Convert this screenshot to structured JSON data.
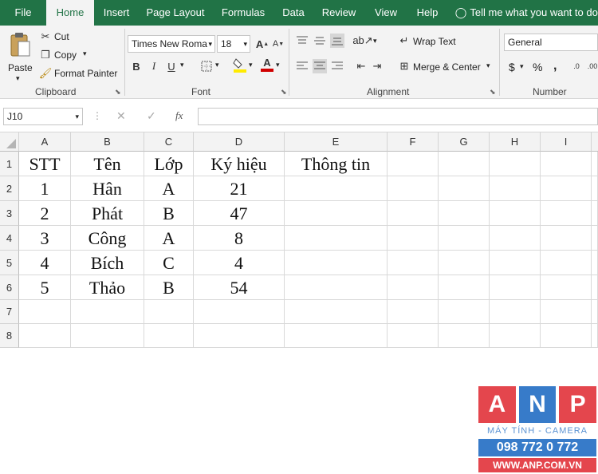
{
  "tabs": [
    "File",
    "Home",
    "Insert",
    "Page Layout",
    "Formulas",
    "Data",
    "Review",
    "View",
    "Help"
  ],
  "tell_me": "Tell me what you want to do",
  "clipboard": {
    "paste": "Paste",
    "cut": "Cut",
    "copy": "Copy",
    "format_painter": "Format Painter",
    "label": "Clipboard"
  },
  "font": {
    "name": "Times New Roma",
    "size": "18",
    "bold": "B",
    "italic": "I",
    "underline": "U",
    "font_color_glyph": "A",
    "label": "Font"
  },
  "alignment": {
    "wrap_text": "Wrap Text",
    "merge_center": "Merge & Center",
    "label": "Alignment"
  },
  "number": {
    "format": "General",
    "currency": "$",
    "percent": "%",
    "comma": ",",
    "label": "Number"
  },
  "formula_bar": {
    "name_box": "J10",
    "fx": "fx",
    "cancel": "✕",
    "enter": "✓"
  },
  "columns": [
    "A",
    "B",
    "C",
    "D",
    "E",
    "F",
    "G",
    "H",
    "I"
  ],
  "rows": [
    "1",
    "2",
    "3",
    "4",
    "5",
    "6",
    "7",
    "8"
  ],
  "cells": [
    [
      "STT",
      "Tên",
      "Lớp",
      "Ký hiệu",
      "Thông tin"
    ],
    [
      "1",
      "Hân",
      "A",
      "21",
      ""
    ],
    [
      "2",
      "Phát",
      "B",
      "47",
      ""
    ],
    [
      "3",
      "Công",
      "A",
      "8",
      ""
    ],
    [
      "4",
      "Bích",
      "C",
      "4",
      ""
    ],
    [
      "5",
      "Thảo",
      "B",
      "54",
      ""
    ]
  ],
  "watermark": {
    "letters": [
      "A",
      "N",
      "P"
    ],
    "tagline": "MÁY TÍNH - CAMERA",
    "phone": "098 772 0 772",
    "site": "WWW.ANP.COM.VN"
  },
  "colors": {
    "excel_green": "#217346",
    "ribbon_bg": "#f3f3f3",
    "font_color": "#d00000",
    "fill_color": "#ffeb00",
    "anp_red": "#e0262f",
    "anp_blue": "#1565c0"
  }
}
